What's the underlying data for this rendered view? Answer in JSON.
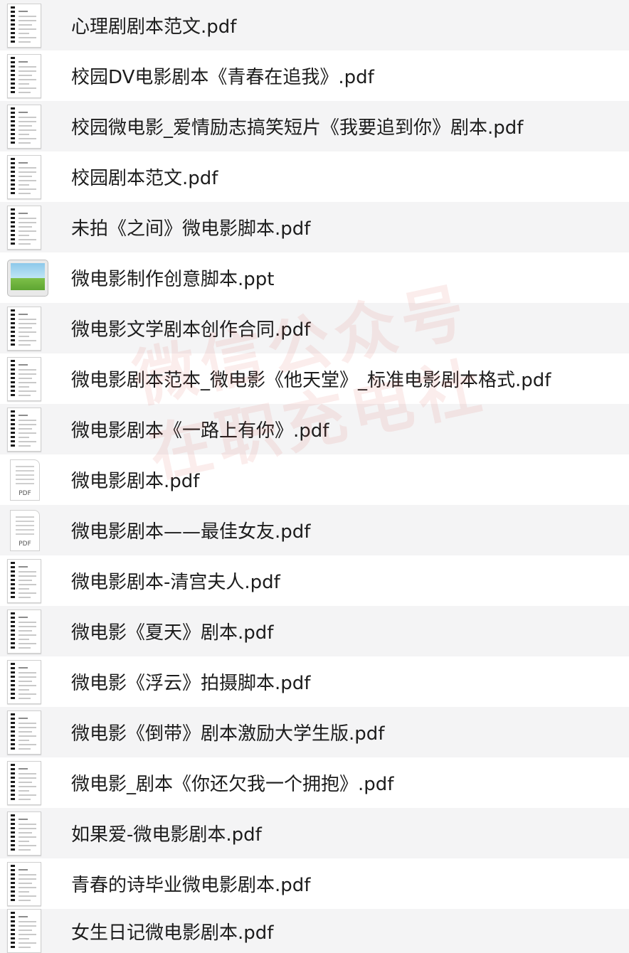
{
  "watermark": {
    "line1": "微信公众号",
    "line2": "在职充电社"
  },
  "files": [
    {
      "name": "心理剧剧本范文.pdf",
      "icon": "document-icon"
    },
    {
      "name": "校园DV电影剧本《青春在追我》.pdf",
      "icon": "document-icon"
    },
    {
      "name": "校园微电影_爱情励志搞笑短片《我要追到你》剧本.pdf",
      "icon": "document-icon"
    },
    {
      "name": "校园剧本范文.pdf",
      "icon": "document-icon"
    },
    {
      "name": "未拍《之间》微电影脚本.pdf",
      "icon": "document-icon"
    },
    {
      "name": "微电影制作创意脚本.ppt",
      "icon": "presentation-icon"
    },
    {
      "name": "微电影文学剧本创作合同.pdf",
      "icon": "document-icon"
    },
    {
      "name": "微电影剧本范本_微电影《他天堂》_标准电影剧本格式.pdf",
      "icon": "document-icon"
    },
    {
      "name": "微电影剧本《一路上有你》.pdf",
      "icon": "document-icon"
    },
    {
      "name": "微电影剧本.pdf",
      "icon": "pdf-icon",
      "tag": "PDF"
    },
    {
      "name": "微电影剧本——最佳女友.pdf",
      "icon": "pdf-icon",
      "tag": "PDF"
    },
    {
      "name": "微电影剧本-清宫夫人.pdf",
      "icon": "document-icon"
    },
    {
      "name": "微电影《夏天》剧本.pdf",
      "icon": "document-icon"
    },
    {
      "name": "微电影《浮云》拍摄脚本.pdf",
      "icon": "document-icon"
    },
    {
      "name": "微电影《倒带》剧本激励大学生版.pdf",
      "icon": "document-icon"
    },
    {
      "name": "微电影_剧本《你还欠我一个拥抱》.pdf",
      "icon": "document-icon"
    },
    {
      "name": "如果爱-微电影剧本.pdf",
      "icon": "document-icon"
    },
    {
      "name": "青春的诗毕业微电影剧本.pdf",
      "icon": "document-icon"
    },
    {
      "name": "女生日记微电影剧本.pdf",
      "icon": "document-icon"
    }
  ]
}
